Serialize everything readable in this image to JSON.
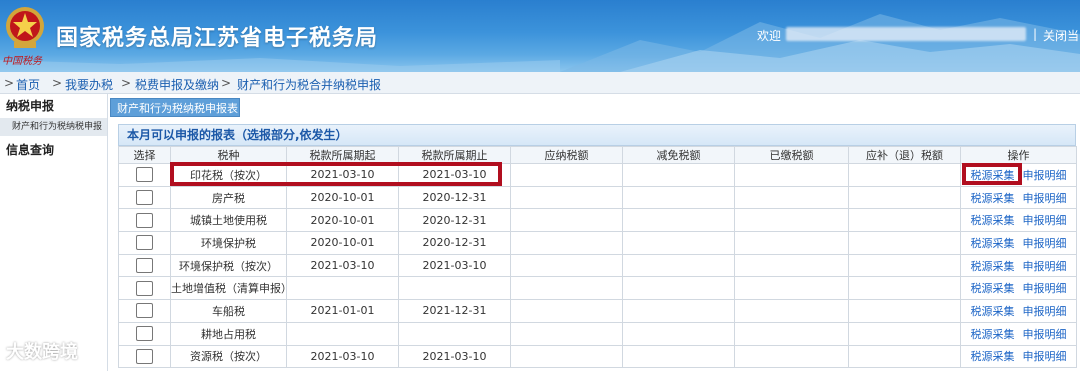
{
  "header": {
    "title": "国家税务总局江苏省电子税务局",
    "emblem_text": "中国税务",
    "welcome": "欢迎",
    "separator": "|",
    "logout": "关闭当"
  },
  "breadcrumb": {
    "items": [
      "首页",
      "我要办税",
      "税费申报及缴纳",
      "财产和行为税合并纳税申报"
    ],
    "sep": ">"
  },
  "sidebar": {
    "section1": "纳税申报",
    "item1": "财产和行为税纳税申报",
    "section2": "信息查询"
  },
  "tab": {
    "label": "财产和行为税纳税申报表"
  },
  "panel": {
    "title": "本月可以申报的报表（选报部分,依发生）"
  },
  "table": {
    "headers": [
      "选择",
      "税种",
      "税款所属期起",
      "税款所属期止",
      "应纳税额",
      "减免税额",
      "已缴税额",
      "应补（退）税额",
      "操作"
    ],
    "op_labels": {
      "collect": "税源采集",
      "detail": "申报明细"
    },
    "rows": [
      {
        "tax": "印花税（按次）",
        "start": "2021-03-10",
        "end": "2021-03-10"
      },
      {
        "tax": "房产税",
        "start": "2020-10-01",
        "end": "2020-12-31"
      },
      {
        "tax": "城镇土地使用税",
        "start": "2020-10-01",
        "end": "2020-12-31"
      },
      {
        "tax": "环境保护税",
        "start": "2020-10-01",
        "end": "2020-12-31"
      },
      {
        "tax": "环境保护税（按次）",
        "start": "2021-03-10",
        "end": "2021-03-10"
      },
      {
        "tax": "土地增值税（清算申报）",
        "start": "",
        "end": ""
      },
      {
        "tax": "车船税",
        "start": "2021-01-01",
        "end": "2021-12-31"
      },
      {
        "tax": "耕地占用税",
        "start": "",
        "end": ""
      },
      {
        "tax": "资源税（按次）",
        "start": "2021-03-10",
        "end": "2021-03-10"
      }
    ]
  },
  "watermark": "大数跨境",
  "colors": {
    "header_blue": "#3c93db",
    "link_blue": "#1b64c6",
    "highlight_red": "#b10e1f"
  }
}
